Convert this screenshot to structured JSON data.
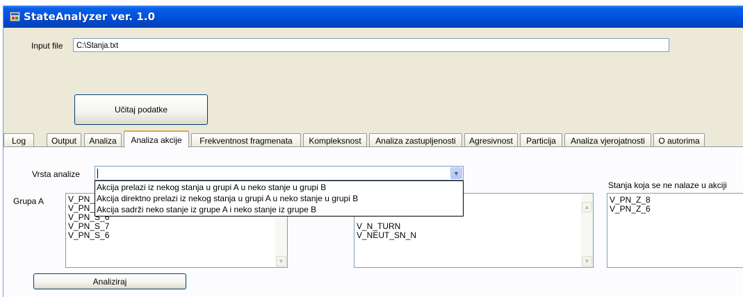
{
  "window": {
    "title": "StateAnalyzer ver. 1.0"
  },
  "input_file": {
    "label": "Input file",
    "value": "C:\\Stanja.txt"
  },
  "load_button": {
    "label": "Učitaj podatke"
  },
  "tabs": [
    {
      "label": "Log"
    },
    {
      "label": "Output"
    },
    {
      "label": "Analiza"
    },
    {
      "label": "Analiza akcije",
      "active": true
    },
    {
      "label": "Frekventnost fragmenata"
    },
    {
      "label": "Kompleksnost"
    },
    {
      "label": "Analiza zastupljenosti"
    },
    {
      "label": "Agresivnost"
    },
    {
      "label": "Particija"
    },
    {
      "label": "Analiza vjerojatnosti"
    },
    {
      "label": "O autorima"
    }
  ],
  "analysis_type": {
    "label": "Vrsta analize",
    "value": "",
    "options": [
      "Akcija prelazi iz nekog stanja u grupi A u neko stanje u grupi B",
      "Akcija direktno prelazi iz nekog stanja u grupi A u neko stanje u grupi B",
      "Akcija sadrži neko stanje iz grupe A i neko stanje iz grupe B"
    ]
  },
  "group_a": {
    "label": "Grupa A",
    "items": [
      "V_PN_",
      "V_PN_",
      "V_PN_S_6",
      "V_PN_S_7",
      "V_PN_S_6"
    ]
  },
  "group_b": {
    "items": [
      "V_N_TURN",
      "V_NEUT_SN_N"
    ]
  },
  "states_not_in_action": {
    "label": "Stanja koja se ne nalaze u akciji",
    "items": [
      "V_PN_Z_8",
      "V_PN_Z_6"
    ]
  },
  "analyze_button": {
    "label": "Analiziraj"
  },
  "icons": {
    "app": "app-window-icon",
    "dropdown": "chevron-down-icon",
    "scroll_up": "scroll-up-arrow-icon",
    "scroll_down": "scroll-down-arrow-icon"
  },
  "colors": {
    "titlebar": "#0054e3",
    "window_bg": "#ece9d8",
    "active_tab_accent": "#e6a23c"
  }
}
